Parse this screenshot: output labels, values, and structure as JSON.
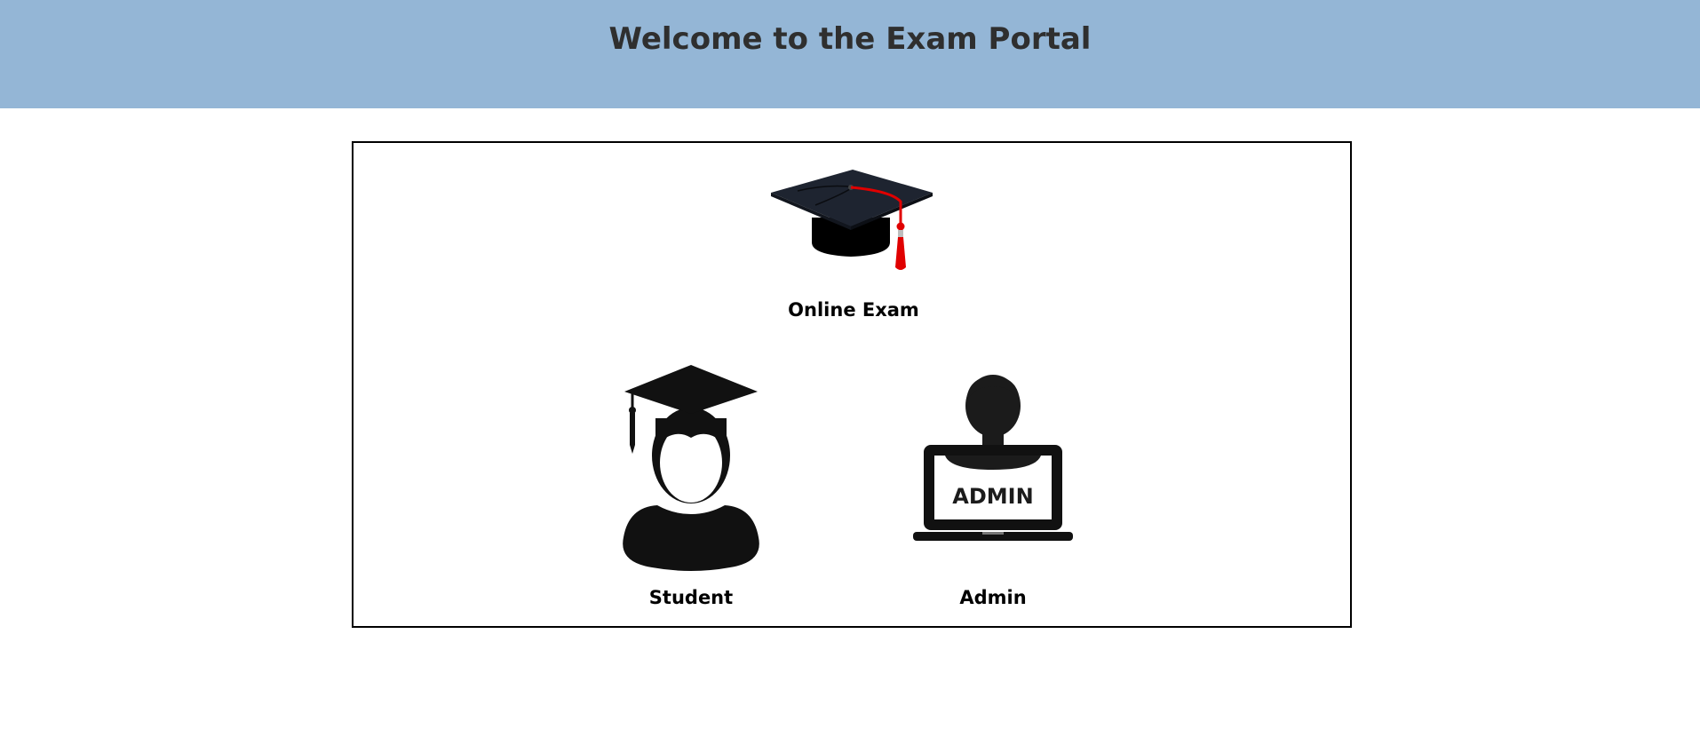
{
  "header": {
    "title": "Welcome to the Exam Portal"
  },
  "brand": {
    "label": "Online Exam",
    "icon": "graduation-cap-icon"
  },
  "roles": [
    {
      "label": "Student",
      "icon": "graduate-student-icon"
    },
    {
      "label": "Admin",
      "icon": "admin-laptop-icon",
      "screen_text": "ADMIN"
    }
  ],
  "colors": {
    "header_bg": "#94b6d6",
    "title_text": "#2f2f2f",
    "tassel": "#e00000",
    "icon_dark": "#111111"
  }
}
